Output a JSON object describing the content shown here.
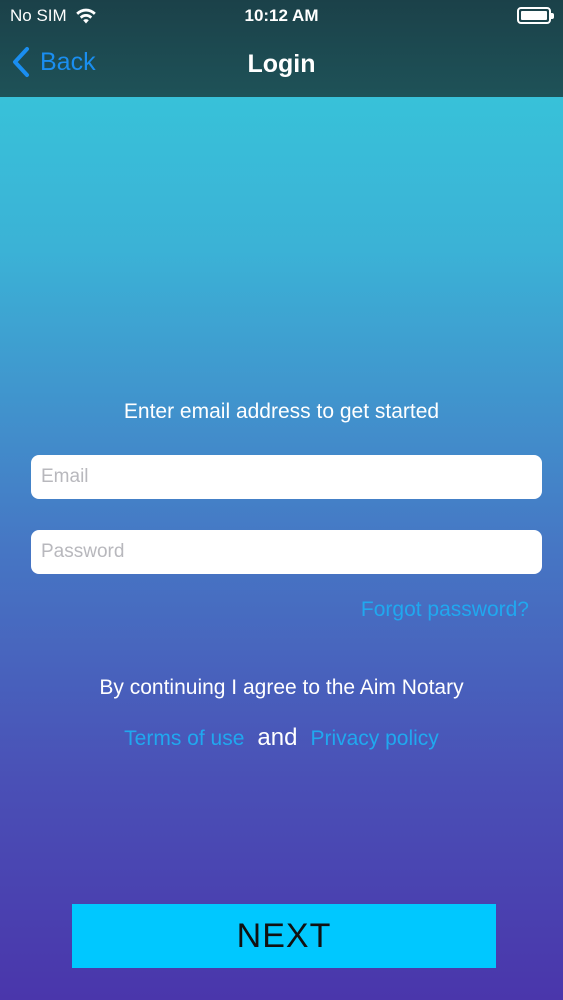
{
  "status_bar": {
    "carrier": "No SIM",
    "time": "10:12 AM",
    "wifi_icon": "wifi-icon",
    "battery_icon": "battery-icon",
    "battery_level": 1.0
  },
  "nav": {
    "back_label": "Back",
    "title": "Login",
    "back_icon": "chevron-left-icon"
  },
  "form": {
    "prompt": "Enter email address to get started",
    "email_placeholder": "Email",
    "email_value": "",
    "password_placeholder": "Password",
    "password_value": "",
    "forgot_label": "Forgot password?"
  },
  "legal": {
    "agree_text": "By continuing I agree to the Aim Notary",
    "terms_label": "Terms of use",
    "and_text": "and",
    "privacy_label": "Privacy policy"
  },
  "actions": {
    "next_label": "NEXT"
  },
  "colors": {
    "accent": "#1a8ef0",
    "link": "#20a8ef",
    "button": "#00c8ff",
    "topbar": "#1c4a50"
  }
}
